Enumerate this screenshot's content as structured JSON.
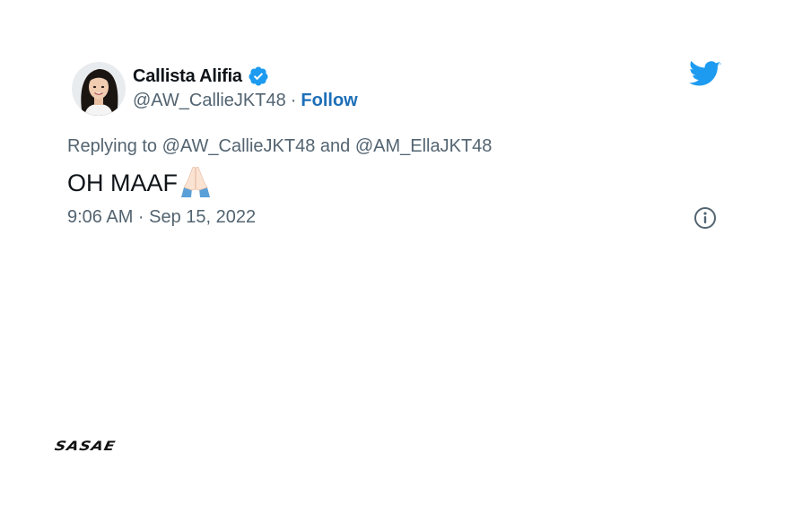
{
  "author": {
    "display_name": "Callista Alifia",
    "handle": "@AW_CallieJKT48",
    "separator": "·",
    "follow_label": "Follow",
    "verified": true
  },
  "reply": {
    "prefix": "Replying to ",
    "mention_1": "@AW_CallieJKT48",
    "conjunction": " and ",
    "mention_2": "@AM_EllaJKT48"
  },
  "tweet": {
    "text": "OH MAAF",
    "emoji": "folded-hands"
  },
  "meta": {
    "timestamp": "9:06 AM · Sep 15, 2022"
  },
  "icons": {
    "brand": "twitter-bird-icon",
    "verified": "verified-badge-icon",
    "info": "info-icon"
  },
  "colors": {
    "brand_blue": "#1d9bf0",
    "follow_blue": "#1d6fb8",
    "secondary_text": "#536471",
    "primary_text": "#0f1419"
  },
  "watermark": {
    "text": "SASAE"
  }
}
